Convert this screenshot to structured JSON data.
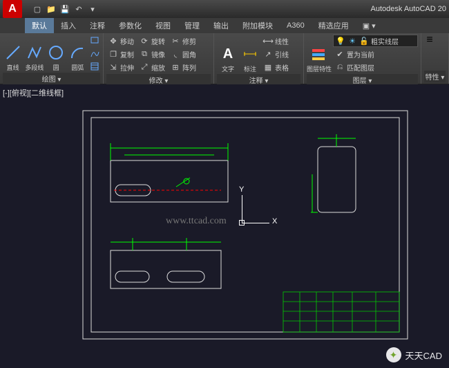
{
  "app": {
    "title": "Autodesk AutoCAD 20",
    "logo_letter": "A"
  },
  "qat": {
    "new": "▢",
    "open": "📁",
    "save": "💾",
    "undo": "↶",
    "more": "▾"
  },
  "menu": {
    "items": [
      "默认",
      "插入",
      "注释",
      "参数化",
      "视图",
      "管理",
      "输出",
      "附加模块",
      "A360",
      "精选应用"
    ],
    "active": 0,
    "extra": "▣ ▾"
  },
  "ribbon": {
    "draw": {
      "title": "绘图 ▾",
      "line": "直线",
      "polyline": "多段线",
      "circle": "圆",
      "arc": "圆弧"
    },
    "modify": {
      "title": "修改 ▾",
      "move": "移动",
      "rotate": "旋转",
      "trim": "修剪",
      "copy": "复制",
      "mirror": "镜像",
      "fillet": "圆角",
      "stretch": "拉伸",
      "scale": "缩放",
      "array": "阵列"
    },
    "annot": {
      "title": "注释 ▾",
      "text": "文字",
      "dim": "标注",
      "linear": "线性",
      "leader": "引线",
      "table": "表格"
    },
    "layer": {
      "title": "图层 ▾",
      "props": "图层特性",
      "current": "粗实线层",
      "make_current": "置为当前",
      "match": "匹配图层"
    },
    "props": {
      "title": "特性 ▾"
    }
  },
  "viewport": {
    "label": "[-][俯视][二维线框]",
    "watermark": "www.ttcad.com",
    "ucs_x": "X",
    "ucs_y": "Y"
  },
  "wechat": {
    "label": "天天CAD"
  }
}
